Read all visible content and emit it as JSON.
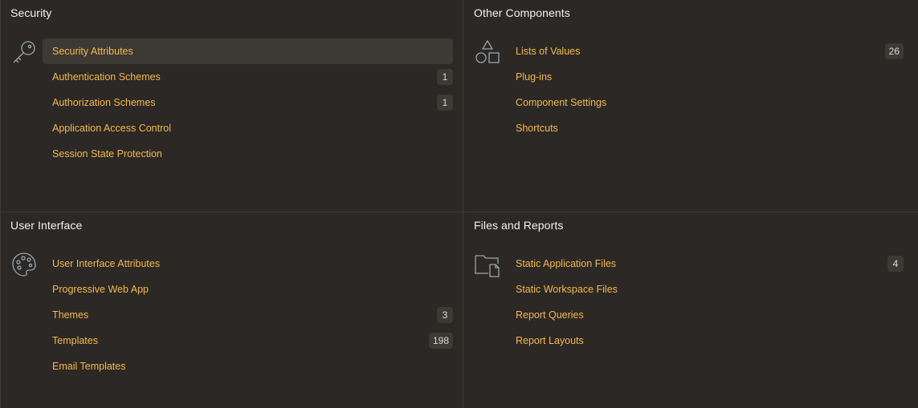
{
  "panels": {
    "security": {
      "title": "Security",
      "icon": "key-icon",
      "items": [
        {
          "label": "Security Attributes",
          "count": "",
          "active": true
        },
        {
          "label": "Authentication Schemes",
          "count": "1"
        },
        {
          "label": "Authorization Schemes",
          "count": "1"
        },
        {
          "label": "Application Access Control",
          "count": ""
        },
        {
          "label": "Session State Protection",
          "count": ""
        }
      ]
    },
    "other": {
      "title": "Other Components",
      "icon": "shapes-icon",
      "items": [
        {
          "label": "Lists of Values",
          "count": "26"
        },
        {
          "label": "Plug-ins",
          "count": ""
        },
        {
          "label": "Component Settings",
          "count": ""
        },
        {
          "label": "Shortcuts",
          "count": ""
        }
      ]
    },
    "ui": {
      "title": "User Interface",
      "icon": "palette-icon",
      "items": [
        {
          "label": "User Interface Attributes",
          "count": ""
        },
        {
          "label": "Progressive Web App",
          "count": ""
        },
        {
          "label": "Themes",
          "count": "3"
        },
        {
          "label": "Templates",
          "count": "198"
        },
        {
          "label": "Email Templates",
          "count": ""
        }
      ]
    },
    "files": {
      "title": "Files and Reports",
      "icon": "folder-file-icon",
      "items": [
        {
          "label": "Static Application Files",
          "count": "4"
        },
        {
          "label": "Static Workspace Files",
          "count": ""
        },
        {
          "label": "Report Queries",
          "count": ""
        },
        {
          "label": "Report Layouts",
          "count": ""
        }
      ]
    }
  },
  "colors": {
    "background": "#2b2825",
    "link": "#f5b94d",
    "heading": "#f4f2ee",
    "badge_bg": "#3d3935",
    "divider": "#3f3b36"
  }
}
